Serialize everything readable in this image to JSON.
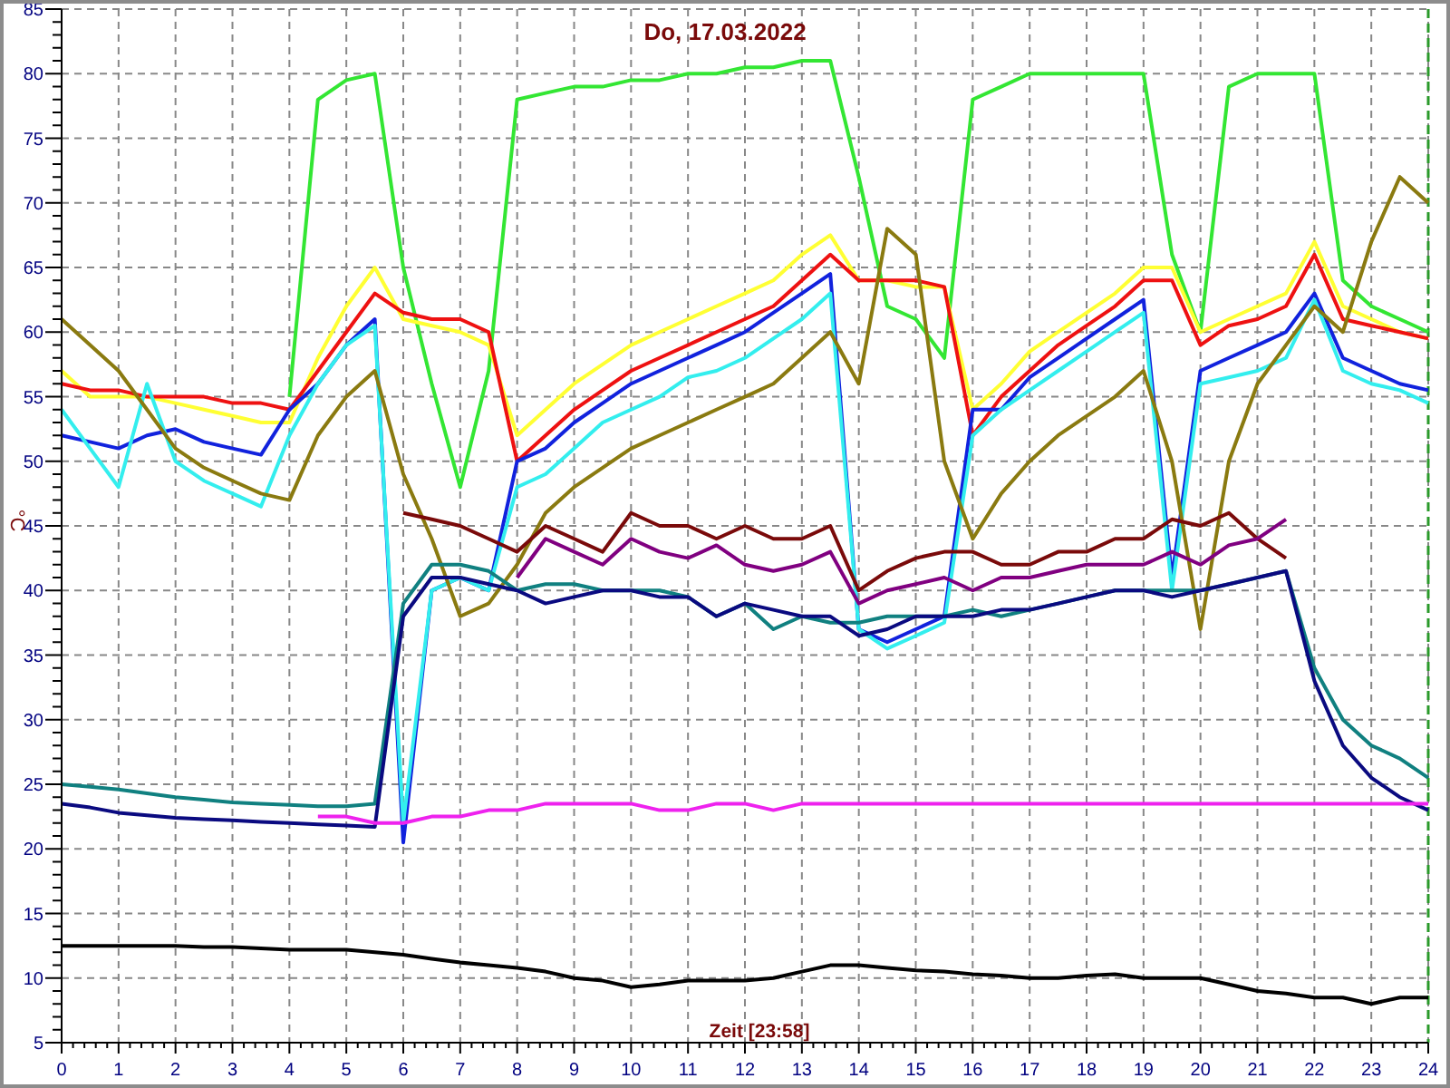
{
  "chart_data": {
    "type": "line",
    "grid": true,
    "title": "Do, 17.03.2022",
    "xlabel": "Zeit [23:58]",
    "ylabel": "°C",
    "x": [
      0,
      0.5,
      1,
      1.5,
      2,
      2.5,
      3,
      3.5,
      4,
      4.5,
      5,
      5.5,
      6,
      6.5,
      7,
      7.5,
      8,
      8.5,
      9,
      9.5,
      10,
      10.5,
      11,
      11.5,
      12,
      12.5,
      13,
      13.5,
      14,
      14.5,
      15,
      15.5,
      16,
      16.5,
      17,
      17.5,
      18,
      18.5,
      19,
      19.5,
      20,
      20.5,
      21,
      21.5,
      22,
      22.5,
      23,
      23.5,
      24
    ],
    "xlim": [
      0,
      24
    ],
    "ylim": [
      5,
      85
    ],
    "xticks": [
      0,
      1,
      2,
      3,
      4,
      5,
      6,
      7,
      8,
      9,
      10,
      11,
      12,
      13,
      14,
      15,
      16,
      17,
      18,
      19,
      20,
      21,
      22,
      23,
      24
    ],
    "yticks": [
      5,
      10,
      15,
      20,
      25,
      30,
      35,
      40,
      45,
      50,
      55,
      60,
      65,
      70,
      75,
      80,
      85
    ],
    "series": [
      {
        "color": "#33e633",
        "values": [
          null,
          null,
          null,
          null,
          null,
          null,
          null,
          null,
          55,
          78,
          79.5,
          80,
          65,
          56,
          48,
          57,
          78,
          78.5,
          79,
          79,
          79.5,
          79.5,
          80,
          80,
          80.5,
          80.5,
          81,
          81,
          72,
          62,
          61,
          58,
          78,
          79,
          80,
          80,
          80,
          80,
          80,
          66,
          60,
          79,
          80,
          80,
          80,
          64,
          62,
          61,
          60
        ]
      },
      {
        "color": "#ffff33",
        "values": [
          57,
          55,
          55,
          55,
          54.5,
          54,
          53.5,
          53,
          53,
          58,
          62,
          65,
          61,
          60.5,
          60,
          59,
          52,
          54,
          56,
          57.5,
          59,
          60,
          61,
          62,
          63,
          64,
          66,
          67.5,
          64,
          64,
          63.5,
          63.5,
          54,
          56,
          58.5,
          60,
          61.5,
          63,
          65,
          65,
          60,
          61,
          62,
          63,
          67,
          62,
          61,
          60,
          59.5
        ]
      },
      {
        "color": "#ee1111",
        "values": [
          56,
          55.5,
          55.5,
          55,
          55,
          55,
          54.5,
          54.5,
          54,
          57,
          60,
          63,
          61.5,
          61,
          61,
          60,
          50,
          52,
          54,
          55.5,
          57,
          58,
          59,
          60,
          61,
          62,
          64,
          66,
          64,
          64,
          64,
          63.5,
          52,
          55,
          57,
          59,
          60.5,
          62,
          64,
          64,
          59,
          60.5,
          61,
          62,
          66,
          61,
          60.5,
          60,
          59.5
        ]
      },
      {
        "color": "#1122dd",
        "values": [
          52,
          51.5,
          51,
          52,
          52.5,
          51.5,
          51,
          50.5,
          54,
          56,
          59,
          61,
          20.5,
          40,
          41,
          40,
          50,
          51,
          53,
          54.5,
          56,
          57,
          58,
          59,
          60,
          61.5,
          63,
          64.5,
          37,
          36,
          37,
          38,
          54,
          54,
          56.5,
          58,
          59.5,
          61,
          62.5,
          41,
          57,
          58,
          59,
          60,
          63,
          58,
          57,
          56,
          55.5
        ]
      },
      {
        "color": "#33eeee",
        "values": [
          54,
          51,
          48,
          56,
          50,
          48.5,
          47.5,
          46.5,
          52,
          56,
          59,
          60.5,
          22,
          40,
          41,
          40,
          48,
          49,
          51,
          53,
          54,
          55,
          56.5,
          57,
          58,
          59.5,
          61,
          63,
          37,
          35.5,
          36.5,
          37.5,
          52,
          54,
          55.5,
          57,
          58.5,
          60,
          61.5,
          40,
          56,
          56.5,
          57,
          58,
          62.5,
          57,
          56,
          55.5,
          54.5
        ]
      },
      {
        "color": "#8a7a10",
        "values": [
          61,
          59,
          57,
          54,
          51,
          49.5,
          48.5,
          47.5,
          47,
          52,
          55,
          57,
          49,
          44,
          38,
          39,
          42,
          46,
          48,
          49.5,
          51,
          52,
          53,
          54,
          55,
          56,
          58,
          60,
          56,
          68,
          66,
          50,
          44,
          47.5,
          50,
          52,
          53.5,
          55,
          57,
          50,
          37,
          50,
          56,
          59,
          62,
          60,
          67,
          72,
          70
        ]
      },
      {
        "color": "#7a0a0a",
        "values": [
          null,
          null,
          null,
          null,
          null,
          null,
          null,
          null,
          null,
          null,
          null,
          null,
          46,
          45.5,
          45,
          44,
          43,
          45,
          44,
          43,
          46,
          45,
          45,
          44,
          45,
          44,
          44,
          45,
          40,
          41.5,
          42.5,
          43,
          43,
          42,
          42,
          43,
          43,
          44,
          44,
          45.5,
          45,
          46,
          44,
          42.5,
          null,
          null,
          null,
          null,
          null
        ]
      },
      {
        "color": "#800080",
        "values": [
          null,
          null,
          null,
          null,
          null,
          null,
          null,
          null,
          null,
          null,
          null,
          null,
          null,
          null,
          null,
          null,
          41,
          44,
          43,
          42,
          44,
          43,
          42.5,
          43.5,
          42,
          41.5,
          42,
          43,
          39,
          40,
          40.5,
          41,
          40,
          41,
          41,
          41.5,
          42,
          42,
          42,
          43,
          42,
          43.5,
          44,
          45.5,
          null,
          null,
          null,
          null,
          null
        ]
      },
      {
        "color": "#108080",
        "values": [
          25,
          24.8,
          24.6,
          24.3,
          24,
          23.8,
          23.6,
          23.5,
          23.4,
          23.3,
          23.3,
          23.5,
          39,
          42,
          42,
          41.5,
          40,
          40.5,
          40.5,
          40,
          40,
          40,
          39.5,
          38,
          39,
          37,
          38,
          37.5,
          37.5,
          38,
          38,
          38,
          38.5,
          38,
          38.5,
          39,
          39.5,
          40,
          40,
          40,
          40,
          40.5,
          41,
          41.5,
          34,
          30,
          28,
          27,
          25.5
        ]
      },
      {
        "color": "#0a0a80",
        "values": [
          23.5,
          23.2,
          22.8,
          22.6,
          22.4,
          22.3,
          22.2,
          22.1,
          22,
          21.9,
          21.8,
          21.7,
          38,
          41,
          41,
          40.5,
          40,
          39,
          39.5,
          40,
          40,
          39.5,
          39.5,
          38,
          39,
          38.5,
          38,
          38,
          36.5,
          37,
          38,
          38,
          38,
          38.5,
          38.5,
          39,
          39.5,
          40,
          40,
          39.5,
          40,
          40.5,
          41,
          41.5,
          33,
          28,
          25.5,
          24,
          23
        ]
      },
      {
        "color": "#ee22ee",
        "values": [
          null,
          null,
          null,
          null,
          null,
          null,
          null,
          null,
          null,
          22.5,
          22.5,
          22,
          22,
          22.5,
          22.5,
          23,
          23,
          23.5,
          23.5,
          23.5,
          23.5,
          23,
          23,
          23.5,
          23.5,
          23,
          23.5,
          23.5,
          23.5,
          23.5,
          23.5,
          23.5,
          23.5,
          23.5,
          23.5,
          23.5,
          23.5,
          23.5,
          23.5,
          23.5,
          23.5,
          23.5,
          23.5,
          23.5,
          23.5,
          23.5,
          23.5,
          23.5,
          23.5
        ]
      },
      {
        "color": "#000000",
        "values": [
          12.5,
          12.5,
          12.5,
          12.5,
          12.5,
          12.4,
          12.4,
          12.3,
          12.2,
          12.2,
          12.2,
          12,
          11.8,
          11.5,
          11.2,
          11,
          10.8,
          10.5,
          10,
          9.8,
          9.3,
          9.5,
          9.8,
          9.8,
          9.8,
          10,
          10.5,
          11,
          11,
          10.8,
          10.6,
          10.5,
          10.3,
          10.2,
          10,
          10,
          10.2,
          10.3,
          10,
          10,
          10,
          9.5,
          9,
          8.8,
          8.5,
          8.5,
          8,
          8.5,
          8.5
        ]
      }
    ]
  }
}
